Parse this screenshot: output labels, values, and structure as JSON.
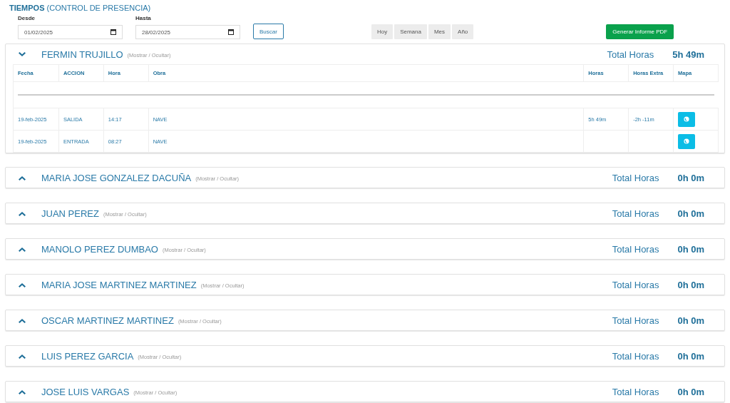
{
  "title": {
    "main": "TIEMPOS",
    "sub": "(CONTROL DE PRESENCIA)"
  },
  "filters": [
    {
      "label": "Desde",
      "value": "01/02/2025"
    },
    {
      "label": "Hasta",
      "value": "28/02/2025"
    }
  ],
  "search_button": "Buscar",
  "range_buttons": [
    "Hoy",
    "Semana",
    "Mes",
    "Año"
  ],
  "report_button": "Generar Informe PDF",
  "employees": [
    {
      "name": "FERMIN TRUJILLO",
      "toggle": "(Mostrar / Ocultar)",
      "total_label": "Total Horas",
      "total": "5h 49m",
      "expanded": true,
      "columns": [
        "Fecha",
        "ACCION",
        "Hora",
        "Obra",
        "Horas",
        "Horas Extra",
        "Mapa"
      ],
      "rows": [
        {
          "fecha": "19-feb-2025",
          "accion": "SALIDA",
          "hora": "14:17",
          "obra": "NAVE",
          "horas": "5h 49m",
          "horas_extra": "-2h -11m"
        },
        {
          "fecha": "19-feb-2025",
          "accion": "ENTRADA",
          "hora": "08:27",
          "obra": "NAVE"
        }
      ]
    },
    {
      "name": "MARIA JOSE GONZALEZ DACUÑA",
      "toggle": "(Mostrar / Ocultar)",
      "total_label": "Total Horas",
      "total": "0h 0m",
      "expanded": false
    },
    {
      "name": "JUAN PEREZ",
      "toggle": "(Mostrar / Ocultar)",
      "total_label": "Total Horas",
      "total": "0h 0m",
      "expanded": false
    },
    {
      "name": "MANOLO PEREZ DUMBAO",
      "toggle": "(Mostrar / Ocultar)",
      "total_label": "Total Horas",
      "total": "0h 0m",
      "expanded": false
    },
    {
      "name": "MARIA JOSE MARTINEZ MARTINEZ",
      "toggle": "(Mostrar / Ocultar)",
      "total_label": "Total Horas",
      "total": "0h 0m",
      "expanded": false
    },
    {
      "name": "OSCAR MARTINEZ MARTINEZ",
      "toggle": "(Mostrar / Ocultar)",
      "total_label": "Total Horas",
      "total": "0h 0m",
      "expanded": false
    },
    {
      "name": "LUIS PEREZ GARCIA",
      "toggle": "(Mostrar / Ocultar)",
      "total_label": "Total Horas",
      "total": "0h 0m",
      "expanded": false
    },
    {
      "name": "JOSE LUIS VARGAS",
      "toggle": "(Mostrar / Ocultar)",
      "total_label": "Total Horas",
      "total": "0h 0m",
      "expanded": false
    }
  ]
}
